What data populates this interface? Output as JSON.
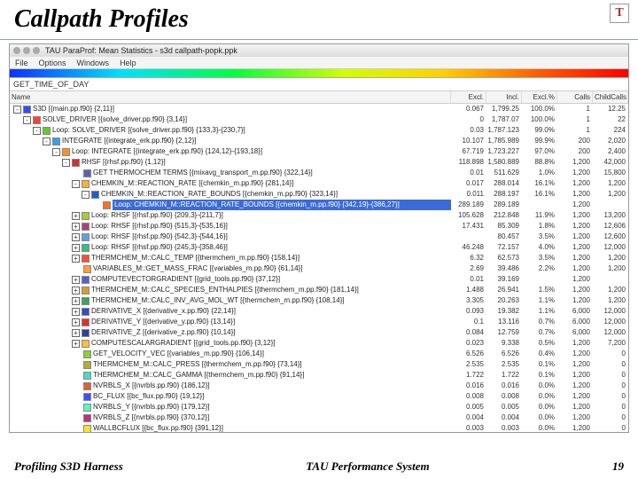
{
  "slide": {
    "title": "Callpath Profiles",
    "footer_left": "Profiling S3D Harness",
    "footer_center": "TAU Performance System",
    "footer_right": "19",
    "logo": "T"
  },
  "window": {
    "title": "TAU ParaProf: Mean Statistics - s3d callpath-popk.ppk",
    "menus": [
      "File",
      "Options",
      "Windows",
      "Help"
    ],
    "metric": "GET_TIME_OF_DAY"
  },
  "columns": [
    "Name",
    "Excl.",
    "Incl.",
    "Excl.%",
    "Calls",
    "ChildCalls"
  ],
  "rows": [
    {
      "d": 0,
      "t": "-",
      "c": "#3050ff",
      "n": "S3D [{main.pp.f90} {2,11}]",
      "v": [
        "0.067",
        "1,799.25",
        "100.0%",
        "1",
        "12.25"
      ]
    },
    {
      "d": 1,
      "t": "-",
      "c": "#ff4030",
      "n": "SOLVE_DRIVER [{solve_driver.pp.f90} {3,14}]",
      "v": [
        "0",
        "1,787.07",
        "100.0%",
        "1",
        "22"
      ]
    },
    {
      "d": 2,
      "t": "-",
      "c": "#60d020",
      "n": "Loop: SOLVE_DRIVER [{solve_driver.pp.f90} {133,3}-{230,7}]",
      "v": [
        "0.03",
        "1,787.123",
        "99.0%",
        "1",
        "224"
      ]
    },
    {
      "d": 3,
      "t": "-",
      "c": "#30a0f0",
      "n": "INTEGRATE [{integrate_erk.pp.f90} {2,12}]",
      "v": [
        "10.107",
        "1,785.989",
        "99.9%",
        "200",
        "2,020"
      ]
    },
    {
      "d": 4,
      "t": "-",
      "c": "#ff9020",
      "n": "Loop: INTEGRATE [{integrate_erk.pp.f90} {124,12}-{193,18}]",
      "v": [
        "67.719",
        "1,723.227",
        "97.0%",
        "200",
        "2,400"
      ]
    },
    {
      "d": 5,
      "t": "-",
      "c": "#d03030",
      "n": "RHSF [{rhsf.pp.f90} {1,12}]",
      "v": [
        "118.898",
        "1,580.889",
        "88.8%",
        "1,200",
        "42,000"
      ]
    },
    {
      "d": 6,
      "t": "",
      "c": "#6060b0",
      "n": "GET THERMOCHEM TERMS [{mixavg_transport_m.pp.f90} {322,14}]",
      "v": [
        "0.01",
        "511.629",
        "1.0%",
        "1,200",
        "15,800"
      ]
    },
    {
      "d": 6,
      "t": "-",
      "c": "#ffb030",
      "n": "CHEMKIN_M::REACTION_RATE [{chemkin_m.pp.f90} {281,14}]",
      "v": [
        "0.017",
        "288.014",
        "16.1%",
        "1,200",
        "1,200"
      ]
    },
    {
      "d": 7,
      "t": "-",
      "c": "#2060c0",
      "n": "CHEMKIN_M::REACTION_RATE_BOUNDS [{chemkin_m.pp.f90} {323,14}]",
      "v": [
        "0.011",
        "288.197",
        "16.1%",
        "1,200",
        "1,200"
      ]
    },
    {
      "d": 8,
      "t": "",
      "c": "#ff7020",
      "n": "Loop: CHEMKIN_M::REACTION_RATE_BOUNDS [{chemkin_m.pp.f90} {342,19}-{386,27}]",
      "v": [
        "289.189",
        "289.189",
        "",
        "1,200",
        ""
      ],
      "sel": true
    },
    {
      "d": 6,
      "t": "+",
      "c": "#a0d030",
      "n": "Loop: RHSF [{rhsf.pp.f90} {209,3}-{211,7}]",
      "v": [
        "105.628",
        "212.848",
        "11.9%",
        "1,200",
        "13,200"
      ]
    },
    {
      "d": 6,
      "t": "+",
      "c": "#b04080",
      "n": "Loop: RHSF [{rhsf.pp.f90} {515,3}-{535,16}]",
      "v": [
        "17.431",
        "85.309",
        "1.8%",
        "1,200",
        "12,606"
      ]
    },
    {
      "d": 6,
      "t": "+",
      "c": "#60a0e0",
      "n": "Loop: RHSF [{rhsf.pp.f90} {542,3}-{544,16}]",
      "v": [
        "",
        "80.457",
        "3.5%",
        "1,200",
        "12,600"
      ]
    },
    {
      "d": 6,
      "t": "+",
      "c": "#30c080",
      "n": "Loop: RHSF [{rhsf.pp.f90} {245,3}-{358,46}]",
      "v": [
        "46.248",
        "72.157",
        "4.0%",
        "1,200",
        "12,000"
      ]
    },
    {
      "d": 6,
      "t": "+",
      "c": "#ff5030",
      "n": "THERMCHEM_M::CALC_TEMP [{thermchem_m.pp.f90} {158,14}]",
      "v": [
        "6.32",
        "62.573",
        "3.5%",
        "1,200",
        "1,200"
      ]
    },
    {
      "d": 6,
      "t": "",
      "c": "#ffa030",
      "n": "VARIABLES_M::GET_MASS_FRAC [{variables_m.pp.f90} {61,14}]",
      "v": [
        "2.69",
        "39.486",
        "2.2%",
        "1,200",
        "1,200"
      ]
    },
    {
      "d": 6,
      "t": "+",
      "c": "#5060d0",
      "n": "COMPUTEVECTORGRADIENT [{grid_tools.pp.f90} {37,12}]",
      "v": [
        "0.01",
        "39.169",
        "",
        "1,200",
        ""
      ]
    },
    {
      "d": 6,
      "t": "+",
      "c": "#d0a030",
      "n": "THERMCHEM_M::CALC_SPECIES_ENTHALPIES [{thermchem_m.pp.f90} {181,14}]",
      "v": [
        "1.488",
        "26.941",
        "1.5%",
        "1,200",
        "1,200"
      ]
    },
    {
      "d": 6,
      "t": "+",
      "c": "#40a060",
      "n": "THERMCHEM_M::CALC_INV_AVG_MOL_WT [{thermchem_m.pp.f90} {108,14}]",
      "v": [
        "3.305",
        "20.263",
        "1.1%",
        "1,200",
        "1,200"
      ]
    },
    {
      "d": 6,
      "t": "+",
      "c": "#3050c0",
      "n": "DERIVATIVE_X [{derivative_x.pp.f90} {22,14}]",
      "v": [
        "0.093",
        "19.382",
        "1.1%",
        "6,000",
        "12,000"
      ]
    },
    {
      "d": 6,
      "t": "+",
      "c": "#e03030",
      "n": "DERIVATIVE_Y [{derivative_y.pp.f90} {13,14}]",
      "v": [
        "0.1",
        "13.116",
        "0.7%",
        "6,000",
        "12,000"
      ]
    },
    {
      "d": 6,
      "t": "+",
      "c": "#3040a0",
      "n": "DERIVATIVE_Z [{derivative_z.pp.f90} {10,14}]",
      "v": [
        "0.084",
        "12.759",
        "0.7%",
        "6,000",
        "12,000"
      ]
    },
    {
      "d": 6,
      "t": "+",
      "c": "#ffc030",
      "n": "COMPUTESCALARGRADIENT [{grid_tools.pp.f90} {3,12}]",
      "v": [
        "0.023",
        "9.338",
        "0.5%",
        "1,200",
        "7,200"
      ]
    },
    {
      "d": 6,
      "t": "",
      "c": "#90d030",
      "n": "GET_VELOCITY_VEC [{variables_m.pp.f90} {106,14}]",
      "v": [
        "6.526",
        "6.526",
        "0.4%",
        "1,200",
        "0"
      ]
    },
    {
      "d": 6,
      "t": "",
      "c": "#b0b030",
      "n": "THERMCHEM_M::CALC_PRESS [{thermchem_m.pp.f90} {73,14}]",
      "v": [
        "2.535",
        "2.535",
        "0.1%",
        "1,200",
        "0"
      ]
    },
    {
      "d": 6,
      "t": "",
      "c": "#40e0c0",
      "n": "THERMCHEM_M::CALC_GAMMA [{thermchem_m.pp.f90} {91,14}]",
      "v": [
        "1.722",
        "1.722",
        "0.1%",
        "1,200",
        "0"
      ]
    },
    {
      "d": 6,
      "t": "",
      "c": "#e06030",
      "n": "NVRBLS_X [{nvrbls.pp.f90} {186,12}]",
      "v": [
        "0.016",
        "0.016",
        "0.0%",
        "1,200",
        "0"
      ]
    },
    {
      "d": 6,
      "t": "",
      "c": "#4050ff",
      "n": "BC_FLUX [{bc_flux.pp.f90} {19,12}]",
      "v": [
        "0.008",
        "0.008",
        "0.0%",
        "1,200",
        "0"
      ]
    },
    {
      "d": 6,
      "t": "",
      "c": "#50ffc0",
      "n": "NVRBLS_Y [{nvrbls.pp.f90} {179,12}]",
      "v": [
        "0.005",
        "0.005",
        "0.0%",
        "1,200",
        "0"
      ]
    },
    {
      "d": 6,
      "t": "",
      "c": "#c03080",
      "n": "NVRBLS_Z [{nvrbls.pp.f90} {370,12}]",
      "v": [
        "0.004",
        "0.004",
        "0.0%",
        "1,200",
        "0"
      ]
    },
    {
      "d": 6,
      "t": "",
      "c": "#ffe030",
      "n": "WALLBCFLUX [{bc_flux.pp.f90} {391,12}]",
      "v": [
        "0.003",
        "0.003",
        "0.0%",
        "1,200",
        "0"
      ]
    }
  ]
}
